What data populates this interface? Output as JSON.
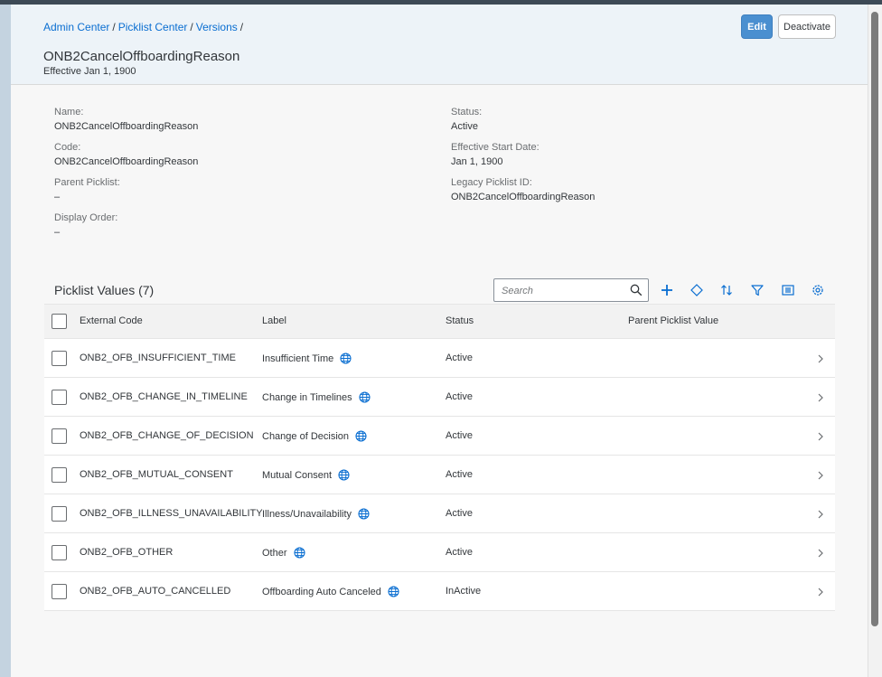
{
  "breadcrumb": {
    "items": [
      "Admin Center",
      "Picklist Center",
      "Versions"
    ],
    "separator": "/"
  },
  "page": {
    "title": "ONB2CancelOffboardingReason",
    "subtitle": "Effective Jan 1, 1900"
  },
  "actions": {
    "edit_label": "Edit",
    "deactivate_label": "Deactivate"
  },
  "details": {
    "name_label": "Name:",
    "name_value": "ONB2CancelOffboardingReason",
    "code_label": "Code:",
    "code_value": "ONB2CancelOffboardingReason",
    "parent_label": "Parent Picklist:",
    "parent_value": "–",
    "order_label": "Display Order:",
    "order_value": "–",
    "status_label": "Status:",
    "status_value": "Active",
    "start_label": "Effective Start Date:",
    "start_value": "Jan 1, 1900",
    "legacy_label": "Legacy Picklist ID:",
    "legacy_value": "ONB2CancelOffboardingReason"
  },
  "values_section": {
    "title": "Picklist Values (7)",
    "search_placeholder": "Search",
    "toolbar_icons": [
      "add-icon",
      "diamond-icon",
      "sort-icon",
      "filter-icon",
      "columns-icon",
      "settings-icon"
    ]
  },
  "table": {
    "columns": [
      "External Code",
      "Label",
      "Status",
      "Parent Picklist Value"
    ],
    "rows": [
      {
        "code": "ONB2_OFB_INSUFFICIENT_TIME",
        "label": "Insufficient Time",
        "status": "Active",
        "parent": ""
      },
      {
        "code": "ONB2_OFB_CHANGE_IN_TIMELINE",
        "label": "Change in Timelines",
        "status": "Active",
        "parent": ""
      },
      {
        "code": "ONB2_OFB_CHANGE_OF_DECISION",
        "label": "Change of Decision",
        "status": "Active",
        "parent": ""
      },
      {
        "code": "ONB2_OFB_MUTUAL_CONSENT",
        "label": "Mutual Consent",
        "status": "Active",
        "parent": ""
      },
      {
        "code": "ONB2_OFB_ILLNESS_UNAVAILABILITY",
        "label": "Illness/Unavailability",
        "status": "Active",
        "parent": ""
      },
      {
        "code": "ONB2_OFB_OTHER",
        "label": "Other",
        "status": "Active",
        "parent": ""
      },
      {
        "code": "ONB2_OFB_AUTO_CANCELLED",
        "label": "Offboarding Auto Canceled",
        "status": "InActive",
        "parent": ""
      }
    ]
  },
  "colors": {
    "link": "#0a6ed1",
    "header_bg": "#edf3f8",
    "emphasized_button": "#4a8fd0",
    "icon_blue": "#0a6ed1"
  }
}
